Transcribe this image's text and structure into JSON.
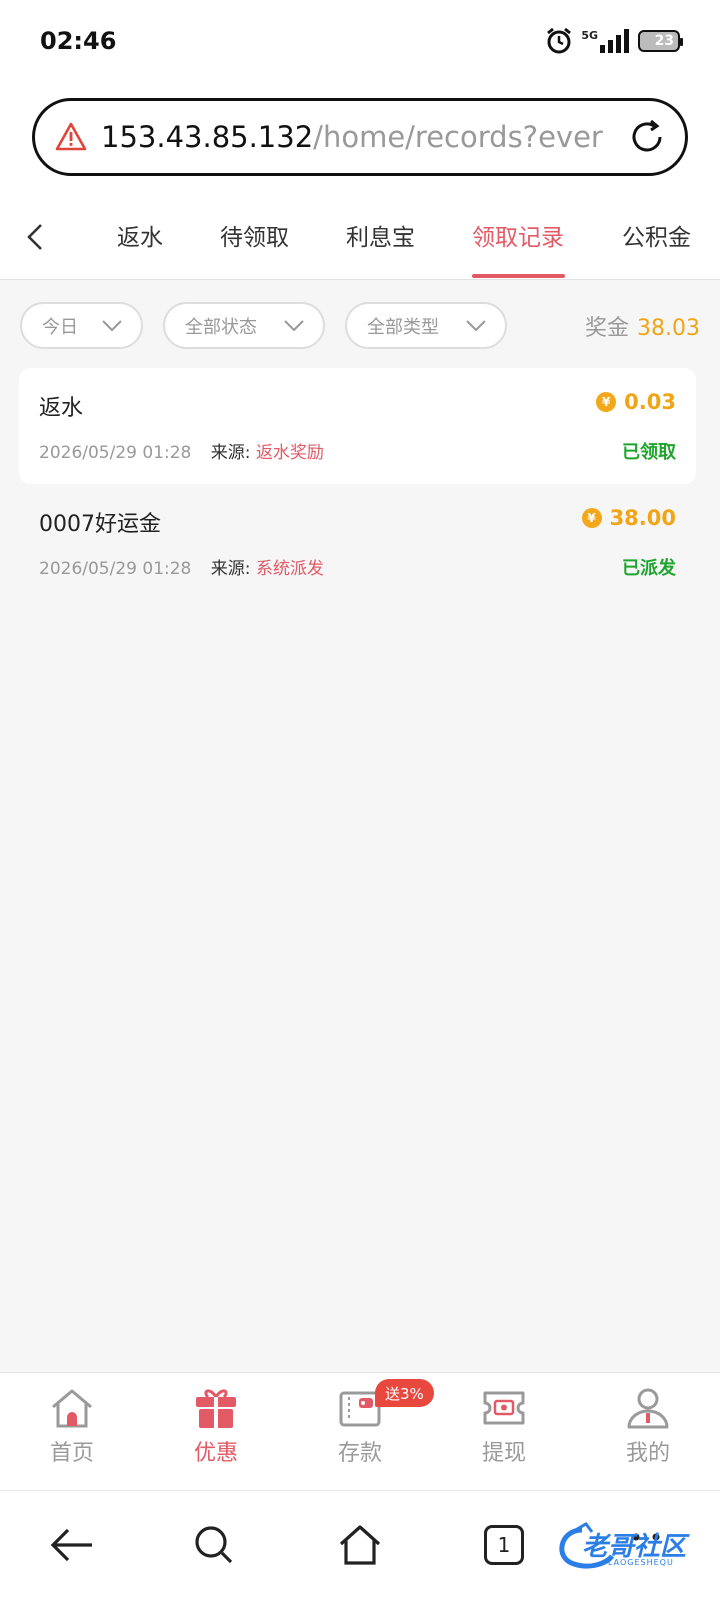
{
  "status_bar": {
    "time": "02:46",
    "network": "5G",
    "battery": "23"
  },
  "browser": {
    "url_host": "153.43.85.132",
    "url_path": "/home/records?ever"
  },
  "tabs": [
    {
      "label": "返水",
      "active": false
    },
    {
      "label": "待领取",
      "active": false
    },
    {
      "label": "利息宝",
      "active": false
    },
    {
      "label": "领取记录",
      "active": true
    },
    {
      "label": "公积金",
      "active": false
    }
  ],
  "filters": {
    "date": "今日",
    "status": "全部状态",
    "type": "全部类型",
    "bonus_label": "奖金",
    "bonus_value": "38.03"
  },
  "records": [
    {
      "title": "返水",
      "amount": "0.03",
      "time": "2026/05/29 01:28",
      "source_label": "来源:",
      "source": "返水奖励",
      "status": "已领取"
    },
    {
      "title": "0007好运金",
      "amount": "38.00",
      "time": "2026/05/29 01:28",
      "source_label": "来源:",
      "source": "系统派发",
      "status": "已派发"
    }
  ],
  "coin_symbol": "¥",
  "bottom_nav": {
    "items": [
      {
        "label": "首页",
        "icon": "home-icon"
      },
      {
        "label": "优惠",
        "icon": "gift-icon"
      },
      {
        "label": "存款",
        "icon": "wallet-icon"
      },
      {
        "label": "提现",
        "icon": "ticket-icon"
      },
      {
        "label": "我的",
        "icon": "user-icon"
      }
    ],
    "deposit_badge": "送3%"
  },
  "system_nav": {
    "tab_count": "1"
  },
  "watermark": {
    "text": "老哥社区",
    "subtext": "LAOGESHEQU"
  },
  "colors": {
    "accent": "#e25a66",
    "gold": "#f0a516",
    "green": "#1fa52d",
    "badge": "#e8483d"
  }
}
